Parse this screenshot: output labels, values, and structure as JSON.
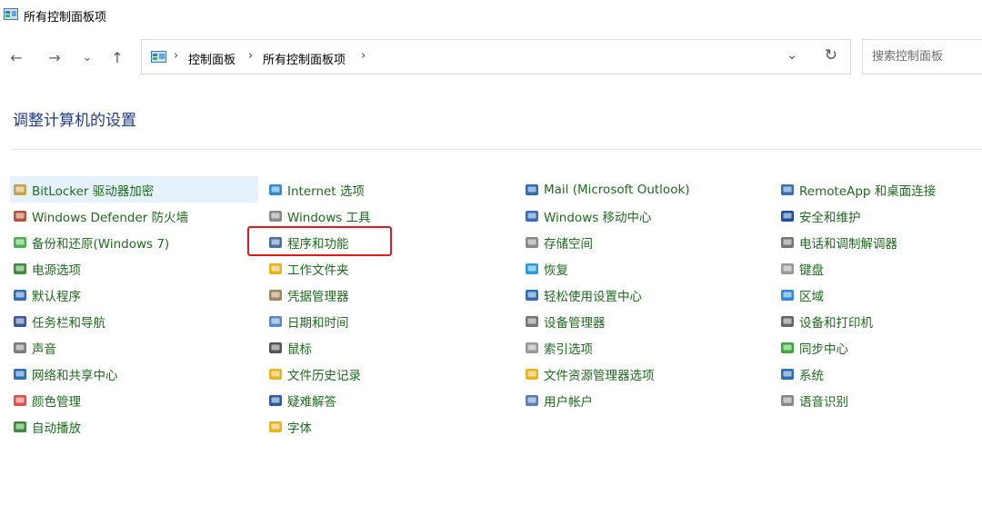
{
  "window": {
    "title": "所有控制面板项"
  },
  "nav": {
    "back": "←",
    "forward": "→",
    "recent": "⌄",
    "up": "↑"
  },
  "address": {
    "crumbs": [
      "控制面板",
      "所有控制面板项"
    ],
    "separator": "›",
    "dropdown": "⌄",
    "refresh": "↻"
  },
  "search": {
    "placeholder": "搜索控制面板"
  },
  "heading": "调整计算机的设置",
  "colors": {
    "link": "#1e6a1e",
    "heading": "#1e3a8a",
    "highlight": "#e5f1fb",
    "annotation": "#e3191b"
  },
  "columns": [
    [
      {
        "label": "BitLocker 驱动器加密",
        "icon": "key-drive-icon",
        "color": "#c8a24a"
      },
      {
        "label": "Windows Defender 防火墙",
        "icon": "firewall-icon",
        "color": "#b5533c"
      },
      {
        "label": "备份和还原(Windows 7)",
        "icon": "backup-icon",
        "color": "#4caf50"
      },
      {
        "label": "电源选项",
        "icon": "power-icon",
        "color": "#3d8b3d"
      },
      {
        "label": "默认程序",
        "icon": "default-programs-icon",
        "color": "#2f6db5"
      },
      {
        "label": "任务栏和导航",
        "icon": "taskbar-icon",
        "color": "#3a5a9c"
      },
      {
        "label": "声音",
        "icon": "speaker-icon",
        "color": "#7a7a7a"
      },
      {
        "label": "网络和共享中心",
        "icon": "network-icon",
        "color": "#2f6db5"
      },
      {
        "label": "颜色管理",
        "icon": "color-management-icon",
        "color": "#d9534f"
      },
      {
        "label": "自动播放",
        "icon": "autoplay-icon",
        "color": "#3a8a3a"
      }
    ],
    [
      {
        "label": "Internet 选项",
        "icon": "globe-icon",
        "color": "#2f8ad8"
      },
      {
        "label": "Windows 工具",
        "icon": "tools-icon",
        "color": "#8a8a8a"
      },
      {
        "label": "程序和功能",
        "icon": "programs-features-icon",
        "color": "#4a6fa5"
      },
      {
        "label": "工作文件夹",
        "icon": "work-folders-icon",
        "color": "#e6b422"
      },
      {
        "label": "凭据管理器",
        "icon": "credential-icon",
        "color": "#a0875a"
      },
      {
        "label": "日期和时间",
        "icon": "clock-icon",
        "color": "#5a8ac8"
      },
      {
        "label": "鼠标",
        "icon": "mouse-icon",
        "color": "#555555"
      },
      {
        "label": "文件历史记录",
        "icon": "file-history-icon",
        "color": "#e6b422"
      },
      {
        "label": "疑难解答",
        "icon": "troubleshoot-icon",
        "color": "#2f5d9c"
      },
      {
        "label": "字体",
        "icon": "font-icon",
        "color": "#e6b422"
      }
    ],
    [
      {
        "label": "Mail (Microsoft Outlook)",
        "icon": "mail-icon",
        "color": "#2f6db5"
      },
      {
        "label": "Windows 移动中心",
        "icon": "mobility-center-icon",
        "color": "#3a6db5"
      },
      {
        "label": "存储空间",
        "icon": "storage-icon",
        "color": "#888888"
      },
      {
        "label": "恢复",
        "icon": "recovery-icon",
        "color": "#2f9ad8"
      },
      {
        "label": "轻松使用设置中心",
        "icon": "ease-of-access-icon",
        "color": "#2f6db5"
      },
      {
        "label": "设备管理器",
        "icon": "device-manager-icon",
        "color": "#777777"
      },
      {
        "label": "索引选项",
        "icon": "indexing-icon",
        "color": "#999999"
      },
      {
        "label": "文件资源管理器选项",
        "icon": "folder-options-icon",
        "color": "#e6b422"
      },
      {
        "label": "用户帐户",
        "icon": "user-accounts-icon",
        "color": "#5a7fb5"
      }
    ],
    [
      {
        "label": "RemoteApp 和桌面连接",
        "icon": "remoteapp-icon",
        "color": "#3a6db5"
      },
      {
        "label": "安全和维护",
        "icon": "security-flag-icon",
        "color": "#1f4e9c"
      },
      {
        "label": "电话和调制解调器",
        "icon": "phone-modem-icon",
        "color": "#777777"
      },
      {
        "label": "键盘",
        "icon": "keyboard-icon",
        "color": "#999999"
      },
      {
        "label": "区域",
        "icon": "region-icon",
        "color": "#2f8ad8"
      },
      {
        "label": "设备和打印机",
        "icon": "printer-icon",
        "color": "#666666"
      },
      {
        "label": "同步中心",
        "icon": "sync-icon",
        "color": "#3aaa3a"
      },
      {
        "label": "系统",
        "icon": "system-icon",
        "color": "#2f6db5"
      },
      {
        "label": "语音识别",
        "icon": "microphone-icon",
        "color": "#888888"
      }
    ]
  ]
}
